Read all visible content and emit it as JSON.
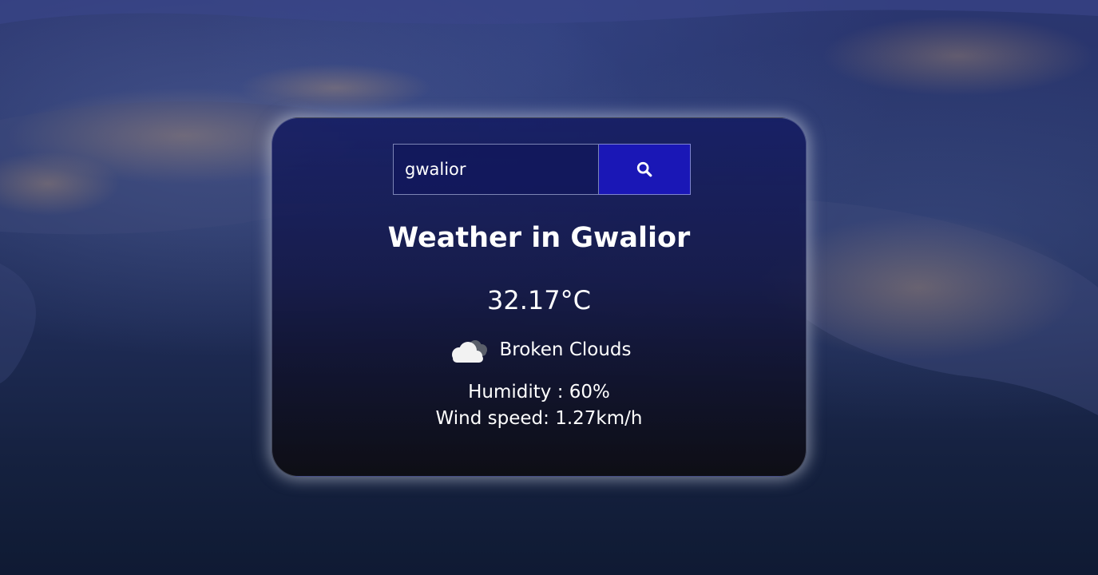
{
  "search": {
    "value": "gwalior",
    "button_icon": "search-icon"
  },
  "weather": {
    "title": "Weather in Gwalior",
    "temperature": "32.17°C",
    "icon": "broken-clouds-icon",
    "description": "Broken Clouds",
    "humidity": "Humidity : 60%",
    "wind": "Wind speed: 1.27km/h"
  },
  "colors": {
    "button": "#1a17b6",
    "text": "#ffffff"
  }
}
